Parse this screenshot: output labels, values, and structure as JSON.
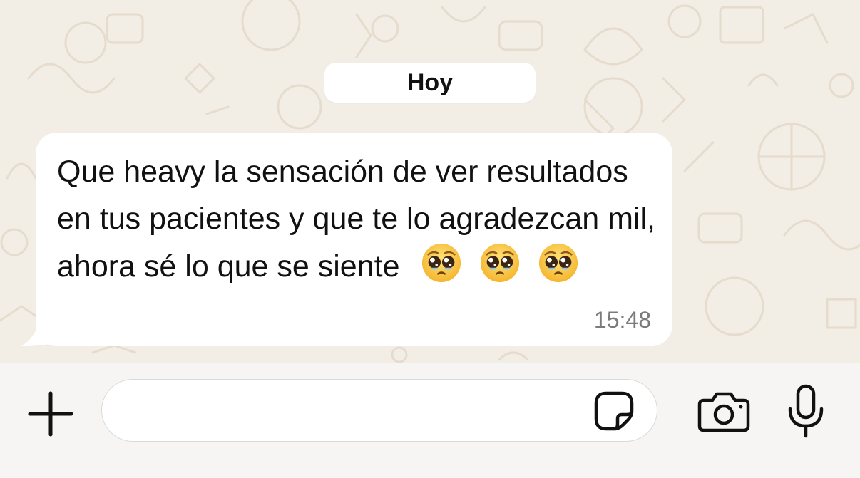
{
  "date_separator": "Hoy",
  "message": {
    "text": "Que heavy la sensación de ver resultados en tus pacientes y que te lo agradezcan mil, ahora sé lo que se siente",
    "emojis": [
      "pleading-face-emoji",
      "pleading-face-emoji",
      "pleading-face-emoji"
    ],
    "time": "15:48",
    "direction": "incoming"
  },
  "composer": {
    "input_value": "",
    "input_placeholder": "",
    "icons": [
      "plus-icon",
      "sticker-icon",
      "camera-icon",
      "microphone-icon"
    ]
  },
  "colors": {
    "chat_background": "#f2ede5",
    "bubble": "#ffffff",
    "timestamp": "#7b7b7b",
    "icon": "#111111"
  }
}
